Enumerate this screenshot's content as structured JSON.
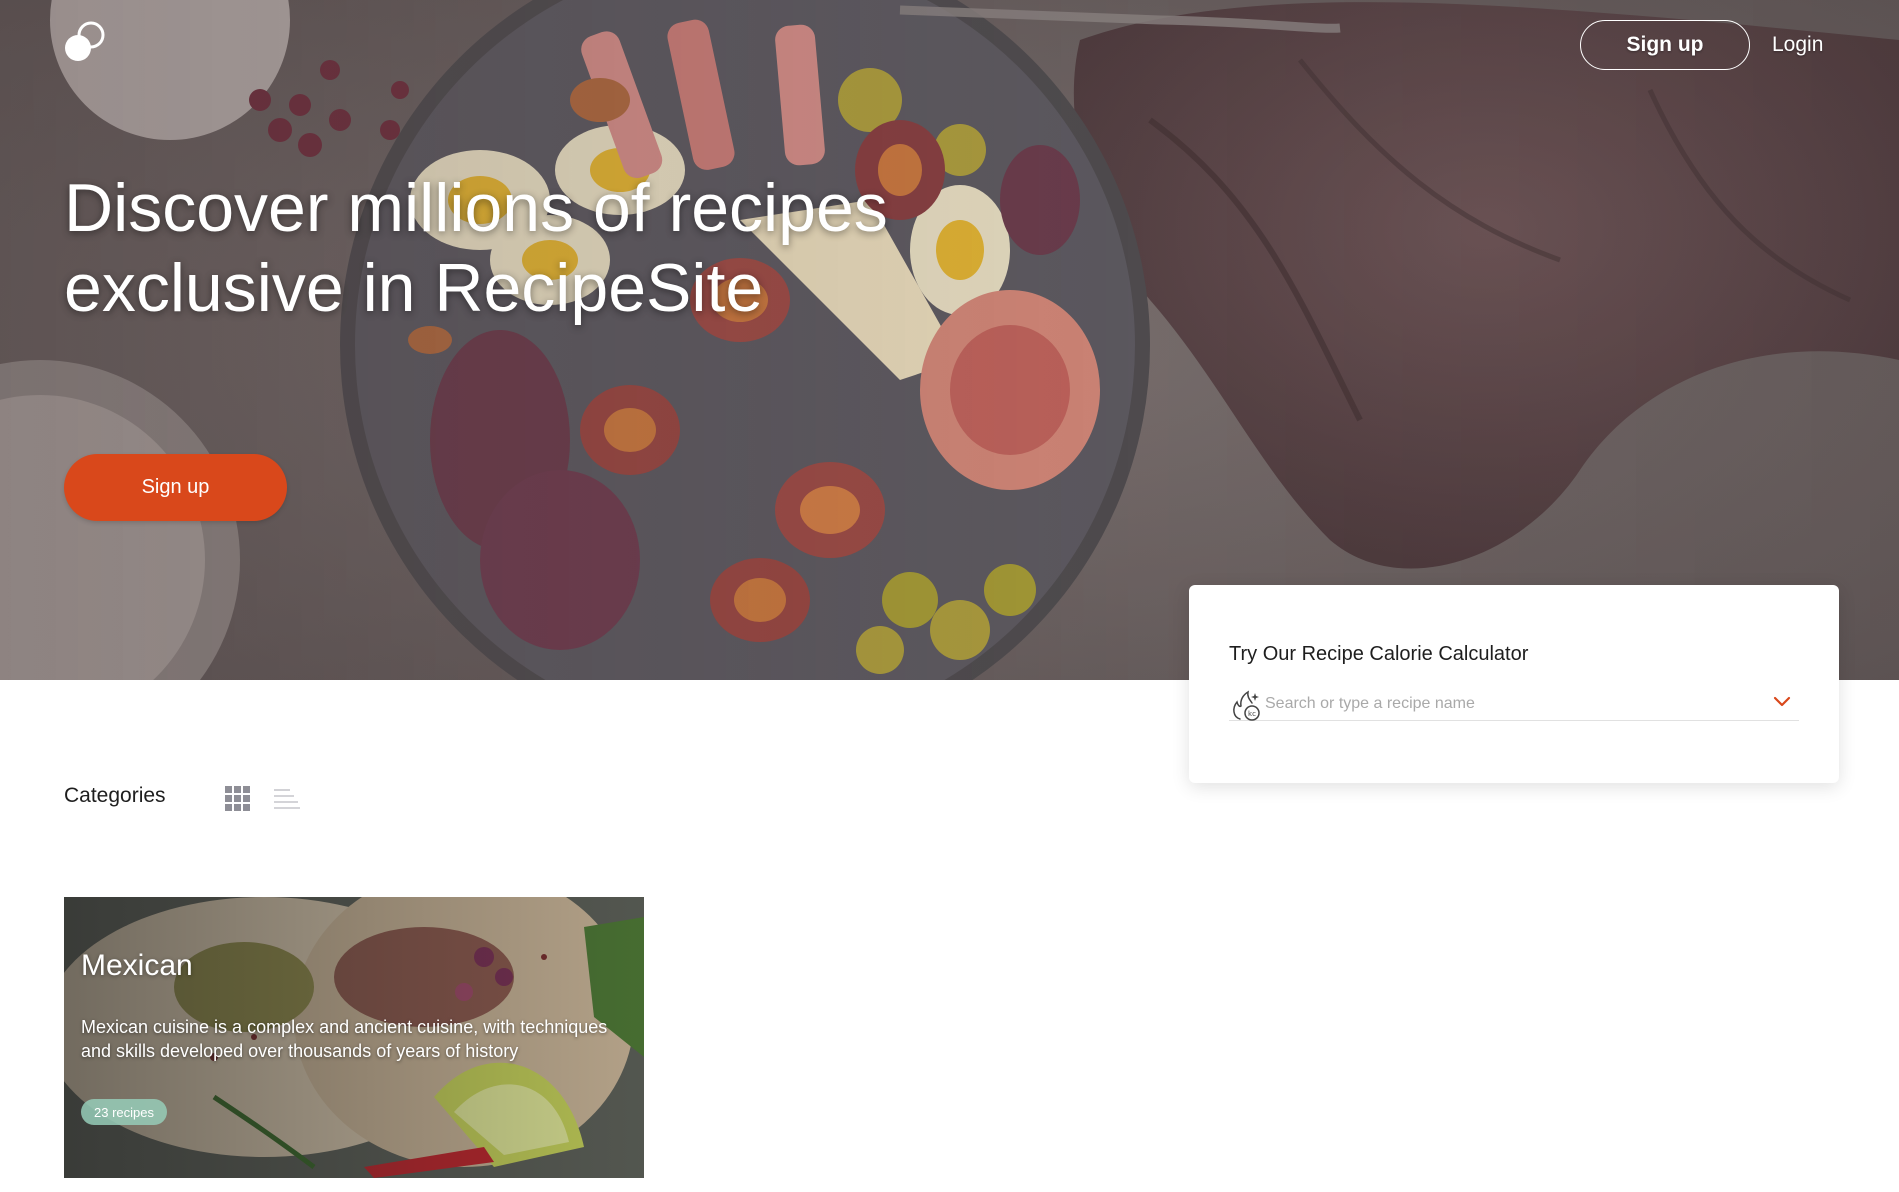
{
  "header": {
    "logo_icon": "two-circles-logo-icon",
    "signup_label": "Sign up",
    "login_label": "Login"
  },
  "hero": {
    "title_line1": "Discover millions of recipes",
    "title_line2": "exclusive in RecipeSite",
    "cta_label": "Sign up",
    "background": "overhead photo of a platter with figs, grapes, olives, eggs, cheese and cured ham on a stone table with a linen cloth"
  },
  "calculator": {
    "title": "Try Our Recipe Calorie Calculator",
    "search_placeholder": "Search or type a recipe name",
    "search_value": "",
    "icon": "calorie-flame-icon",
    "dropdown_icon": "chevron-down-icon"
  },
  "categories": {
    "title": "Categories",
    "view_grid_icon": "grid-view-icon",
    "view_list_icon": "list-view-icon",
    "items": [
      {
        "name": "Mexican",
        "description": "Mexican cuisine is a complex and ancient cuisine, with techniques and skills developed over thousands of years of history",
        "count": "23 recipes"
      }
    ]
  },
  "colors": {
    "accent": "#d9481b",
    "text_dark": "#1e1e1e",
    "badge": "#96cdb9",
    "chevron": "#d9481b"
  }
}
